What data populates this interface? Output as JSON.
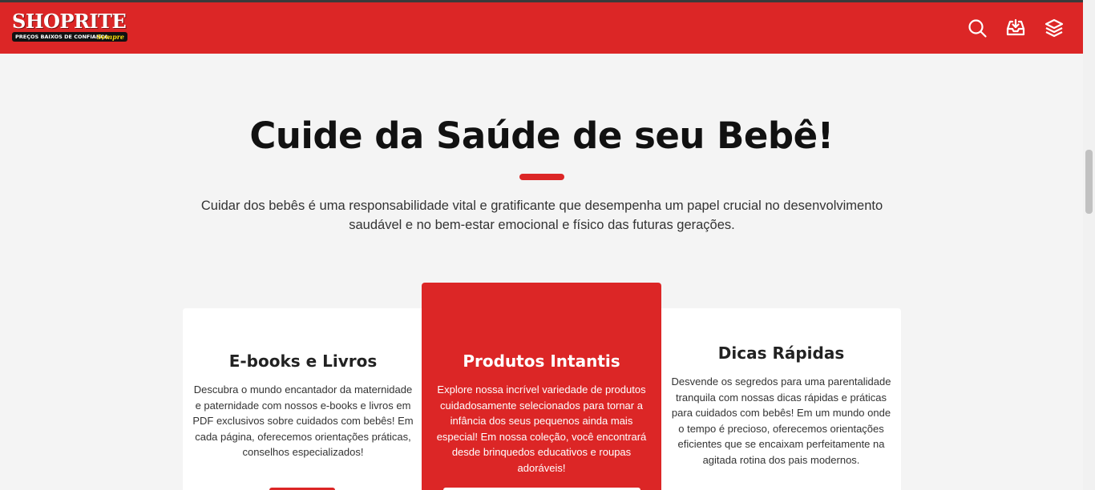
{
  "header": {
    "logo_word": "SHOPRITE",
    "logo_tagline": "PREÇOS BAIXOS DE CONFIANÇA",
    "logo_script": "Sempre",
    "icons": [
      "search-icon",
      "inbox-download-icon",
      "layers-icon"
    ]
  },
  "hero": {
    "title": "Cuide da Saúde de seu Bebê!",
    "intro": "Cuidar dos bebês é uma responsabilidade vital e gratificante que desempenha um papel crucial no desenvolvimento saudável e no bem-estar emocional e físico das futuras gerações."
  },
  "cards": [
    {
      "title": "E-books e Livros",
      "text": "Descubra o mundo encantador da maternidade e paternidade com nossos e-books e livros em PDF exclusivos sobre cuidados com bebês! Em cada página, oferecemos orientações práticas, conselhos especializados!"
    },
    {
      "title": "Produtos Intantis",
      "text": "Explore nossa incrível variedade de produtos cuidadosamente selecionados para tornar a infância dos seus pequenos ainda mais especial! Em nossa coleção, você encontrará desde brinquedos educativos e roupas adoráveis!"
    },
    {
      "title": "Dicas Rápidas",
      "text": "Desvende os segredos para uma parentalidade tranquila com nossas dicas rápidas e práticas para cuidados com bebês! Em um mundo onde o tempo é precioso, oferecemos orientações eficientes que se encaixam perfeitamente na agitada rotina dos pais modernos."
    }
  ],
  "colors": {
    "brand_red": "#dc2626",
    "background": "#f4f4f4",
    "card_bg": "#ffffff"
  }
}
